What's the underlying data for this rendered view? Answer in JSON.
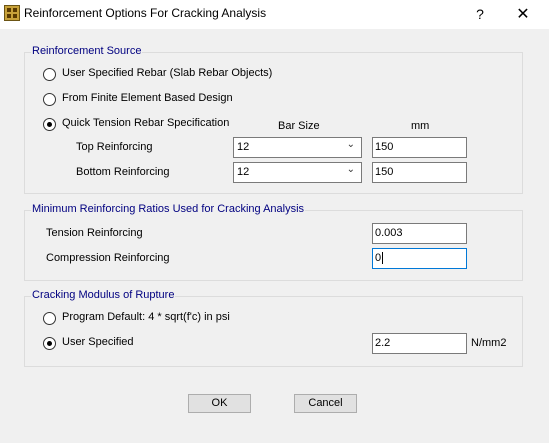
{
  "window": {
    "title": "Reinforcement Options For Cracking Analysis",
    "help_label": "?",
    "close_label": "✕"
  },
  "reinforcement_source": {
    "legend": "Reinforcement Source",
    "options": [
      {
        "label": "User Specified Rebar  (Slab Rebar Objects)",
        "checked": false
      },
      {
        "label": "From Finite Element Based Design",
        "checked": false
      },
      {
        "label": "Quick Tension Rebar Specification",
        "checked": true
      }
    ],
    "bar_size_header": "Bar Size",
    "mm_header": "mm",
    "top": {
      "label": "Top Reinforcing",
      "bar_size": "12",
      "mm": "150"
    },
    "bottom": {
      "label": "Bottom Reinforcing",
      "bar_size": "12",
      "mm": "150"
    }
  },
  "min_ratios": {
    "legend": "Minimum Reinforcing Ratios Used for Cracking Analysis",
    "tension": {
      "label": "Tension Reinforcing",
      "value": "0.003"
    },
    "compression": {
      "label": "Compression Reinforcing",
      "value": "0"
    }
  },
  "modulus": {
    "legend": "Cracking Modulus of Rupture",
    "program_default": {
      "label": "Program Default:  4 * sqrt(f'c) in psi",
      "checked": false
    },
    "user_specified": {
      "label": "User Specified",
      "checked": true,
      "value": "2.2",
      "unit": "N/mm2"
    }
  },
  "buttons": {
    "ok": "OK",
    "cancel": "Cancel"
  }
}
